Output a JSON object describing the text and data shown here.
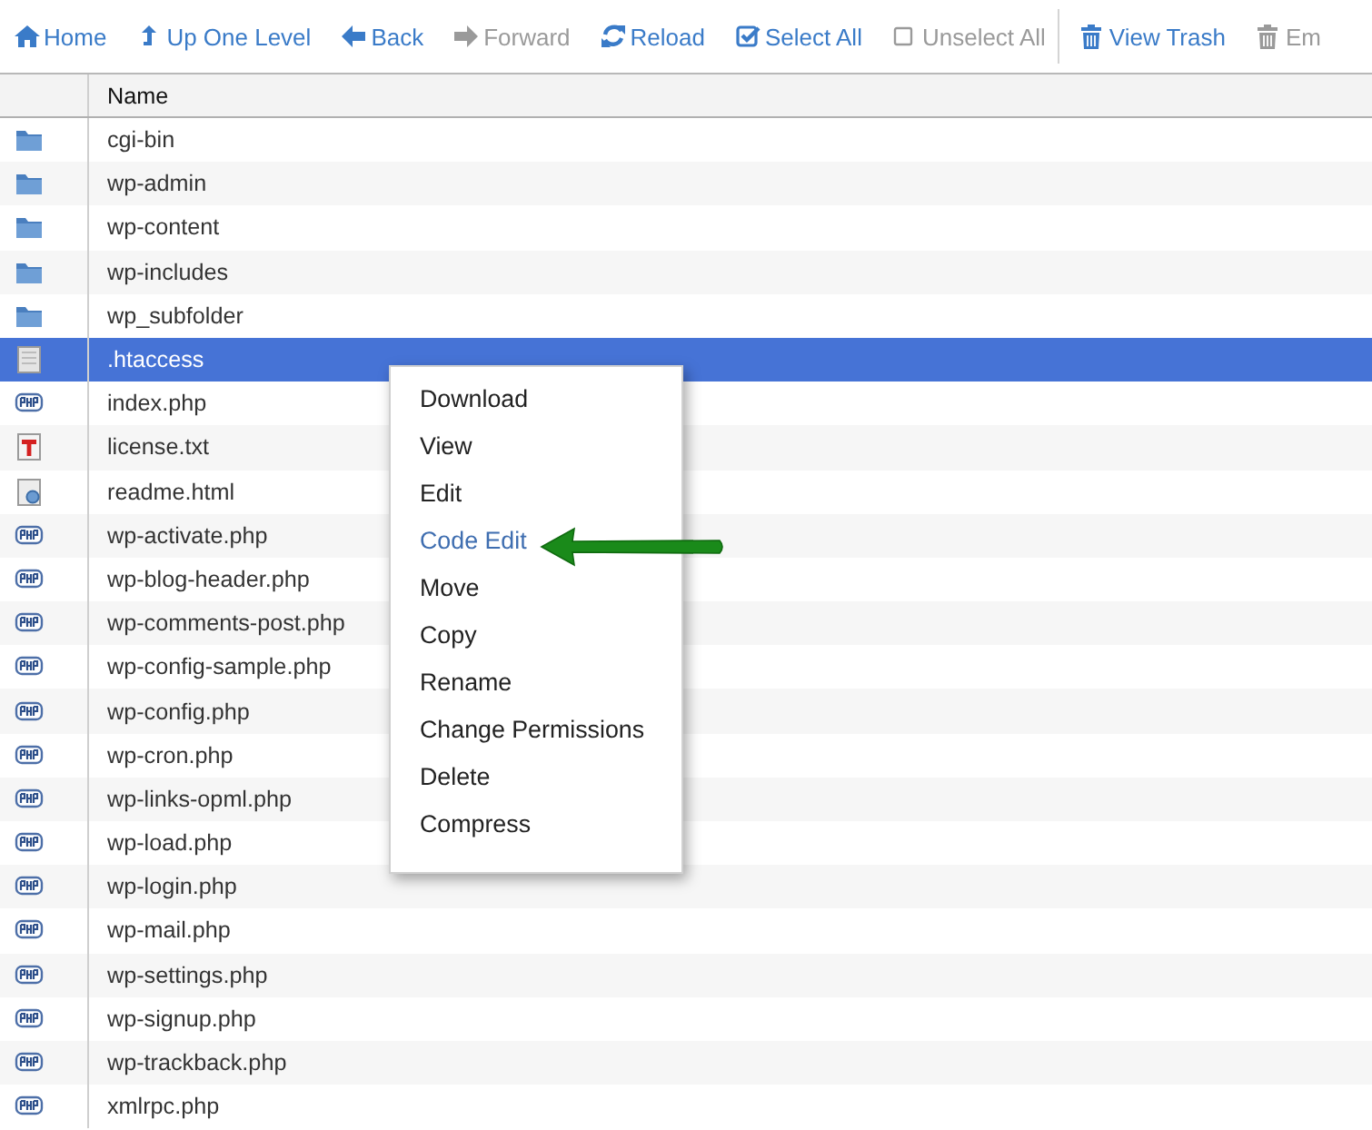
{
  "toolbar": {
    "groups": [
      {
        "buttons": [
          {
            "label": "Home",
            "kind": "home",
            "disabled": false
          },
          {
            "label": "Up One Level",
            "kind": "up",
            "disabled": false
          },
          {
            "label": "Back",
            "kind": "back",
            "disabled": false
          },
          {
            "label": "Forward",
            "kind": "forward",
            "disabled": true
          },
          {
            "label": "Reload",
            "kind": "reload",
            "disabled": false
          },
          {
            "label": "Select All",
            "kind": "select",
            "disabled": false
          },
          {
            "label": "Unselect All",
            "kind": "unselect",
            "disabled": true
          }
        ]
      },
      {
        "buttons": [
          {
            "label": "View Trash",
            "kind": "trash",
            "disabled": false
          },
          {
            "label": "Em",
            "kind": "trash",
            "disabled": true
          }
        ]
      }
    ]
  },
  "table": {
    "columns": [
      "Name"
    ],
    "rows": [
      {
        "name": "cgi-bin",
        "kind": "folder",
        "selected": false
      },
      {
        "name": "wp-admin",
        "kind": "folder",
        "selected": false
      },
      {
        "name": "wp-content",
        "kind": "folder",
        "selected": false
      },
      {
        "name": "wp-includes",
        "kind": "folder",
        "selected": false
      },
      {
        "name": "wp_subfolder",
        "kind": "folder",
        "selected": false
      },
      {
        "name": ".htaccess",
        "kind": "file",
        "selected": true
      },
      {
        "name": "index.php",
        "kind": "php",
        "selected": false
      },
      {
        "name": "license.txt",
        "kind": "text",
        "selected": false
      },
      {
        "name": "readme.html",
        "kind": "html",
        "selected": false
      },
      {
        "name": "wp-activate.php",
        "kind": "php",
        "selected": false
      },
      {
        "name": "wp-blog-header.php",
        "kind": "php",
        "selected": false
      },
      {
        "name": "wp-comments-post.php",
        "kind": "php",
        "selected": false
      },
      {
        "name": "wp-config-sample.php",
        "kind": "php",
        "selected": false
      },
      {
        "name": "wp-config.php",
        "kind": "php",
        "selected": false
      },
      {
        "name": "wp-cron.php",
        "kind": "php",
        "selected": false
      },
      {
        "name": "wp-links-opml.php",
        "kind": "php",
        "selected": false
      },
      {
        "name": "wp-load.php",
        "kind": "php",
        "selected": false
      },
      {
        "name": "wp-login.php",
        "kind": "php",
        "selected": false
      },
      {
        "name": "wp-mail.php",
        "kind": "php",
        "selected": false
      },
      {
        "name": "wp-settings.php",
        "kind": "php",
        "selected": false
      },
      {
        "name": "wp-signup.php",
        "kind": "php",
        "selected": false
      },
      {
        "name": "wp-trackback.php",
        "kind": "php",
        "selected": false
      },
      {
        "name": "xmlrpc.php",
        "kind": "php",
        "selected": false
      }
    ]
  },
  "context_menu": {
    "items": [
      {
        "label": "Download",
        "selected": false
      },
      {
        "label": "View",
        "selected": false
      },
      {
        "label": "Edit",
        "selected": false
      },
      {
        "label": "Code Edit",
        "selected": true
      },
      {
        "label": "Move",
        "selected": false
      },
      {
        "label": "Copy",
        "selected": false
      },
      {
        "label": "Rename",
        "selected": false
      },
      {
        "label": "Change Permissions",
        "selected": false
      },
      {
        "label": "Delete",
        "selected": false
      },
      {
        "label": "Compress",
        "selected": false
      }
    ]
  },
  "annotation": {
    "kind": "arrow"
  }
}
